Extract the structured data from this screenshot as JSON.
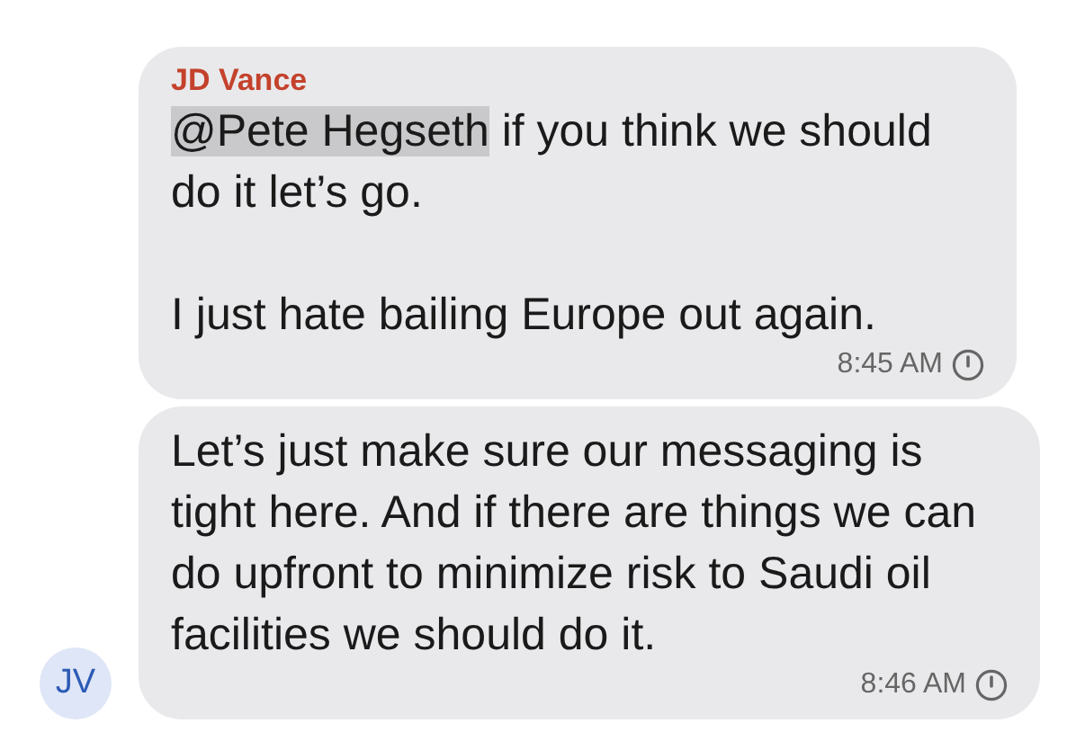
{
  "messages": [
    {
      "sender": "JD Vance",
      "paragraphs": [
        [
          {
            "kind": "mention",
            "text": "@Pete Hegseth"
          },
          {
            "kind": "text",
            "text": " if you think we should do it let’s go."
          }
        ],
        [
          {
            "kind": "text",
            "text": "I just hate bailing Europe out again."
          }
        ]
      ],
      "time": "8:45 AM"
    },
    {
      "avatar": "JV",
      "paragraphs": [
        [
          {
            "kind": "text",
            "text": "Let’s just make sure our messaging is tight here. And if there are things we can do upfront to minimize risk to Saudi oil facilities we should do it."
          }
        ]
      ],
      "time": "8:46 AM"
    }
  ]
}
